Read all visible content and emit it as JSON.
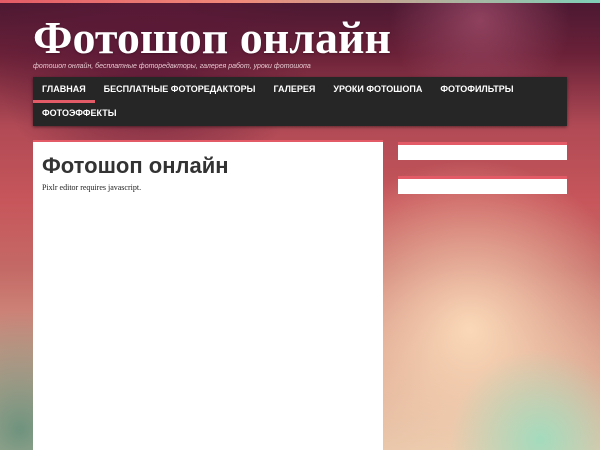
{
  "header": {
    "title": "Фотошоп онлайн",
    "description": "фотошоп онлайн, бесплатные фоторедакторы, галерея работ, уроки фотошопа"
  },
  "nav": {
    "items": [
      {
        "label": "ГЛАВНАЯ",
        "active": true
      },
      {
        "label": "БЕСПЛАТНЫЕ ФОТОРЕДАКТОРЫ",
        "active": false
      },
      {
        "label": "ГАЛЕРЕЯ",
        "active": false
      },
      {
        "label": "УРОКИ ФОТОШОПА",
        "active": false
      },
      {
        "label": "ФОТОФИЛЬТРЫ",
        "active": false
      },
      {
        "label": "ФОТОЭФФЕКТЫ",
        "active": false
      }
    ]
  },
  "main": {
    "post_title": "Фотошоп онлайн",
    "post_body": "Pixlr editor requires javascript."
  },
  "colors": {
    "accent": "#e35b66",
    "nav_background": "#262626"
  }
}
